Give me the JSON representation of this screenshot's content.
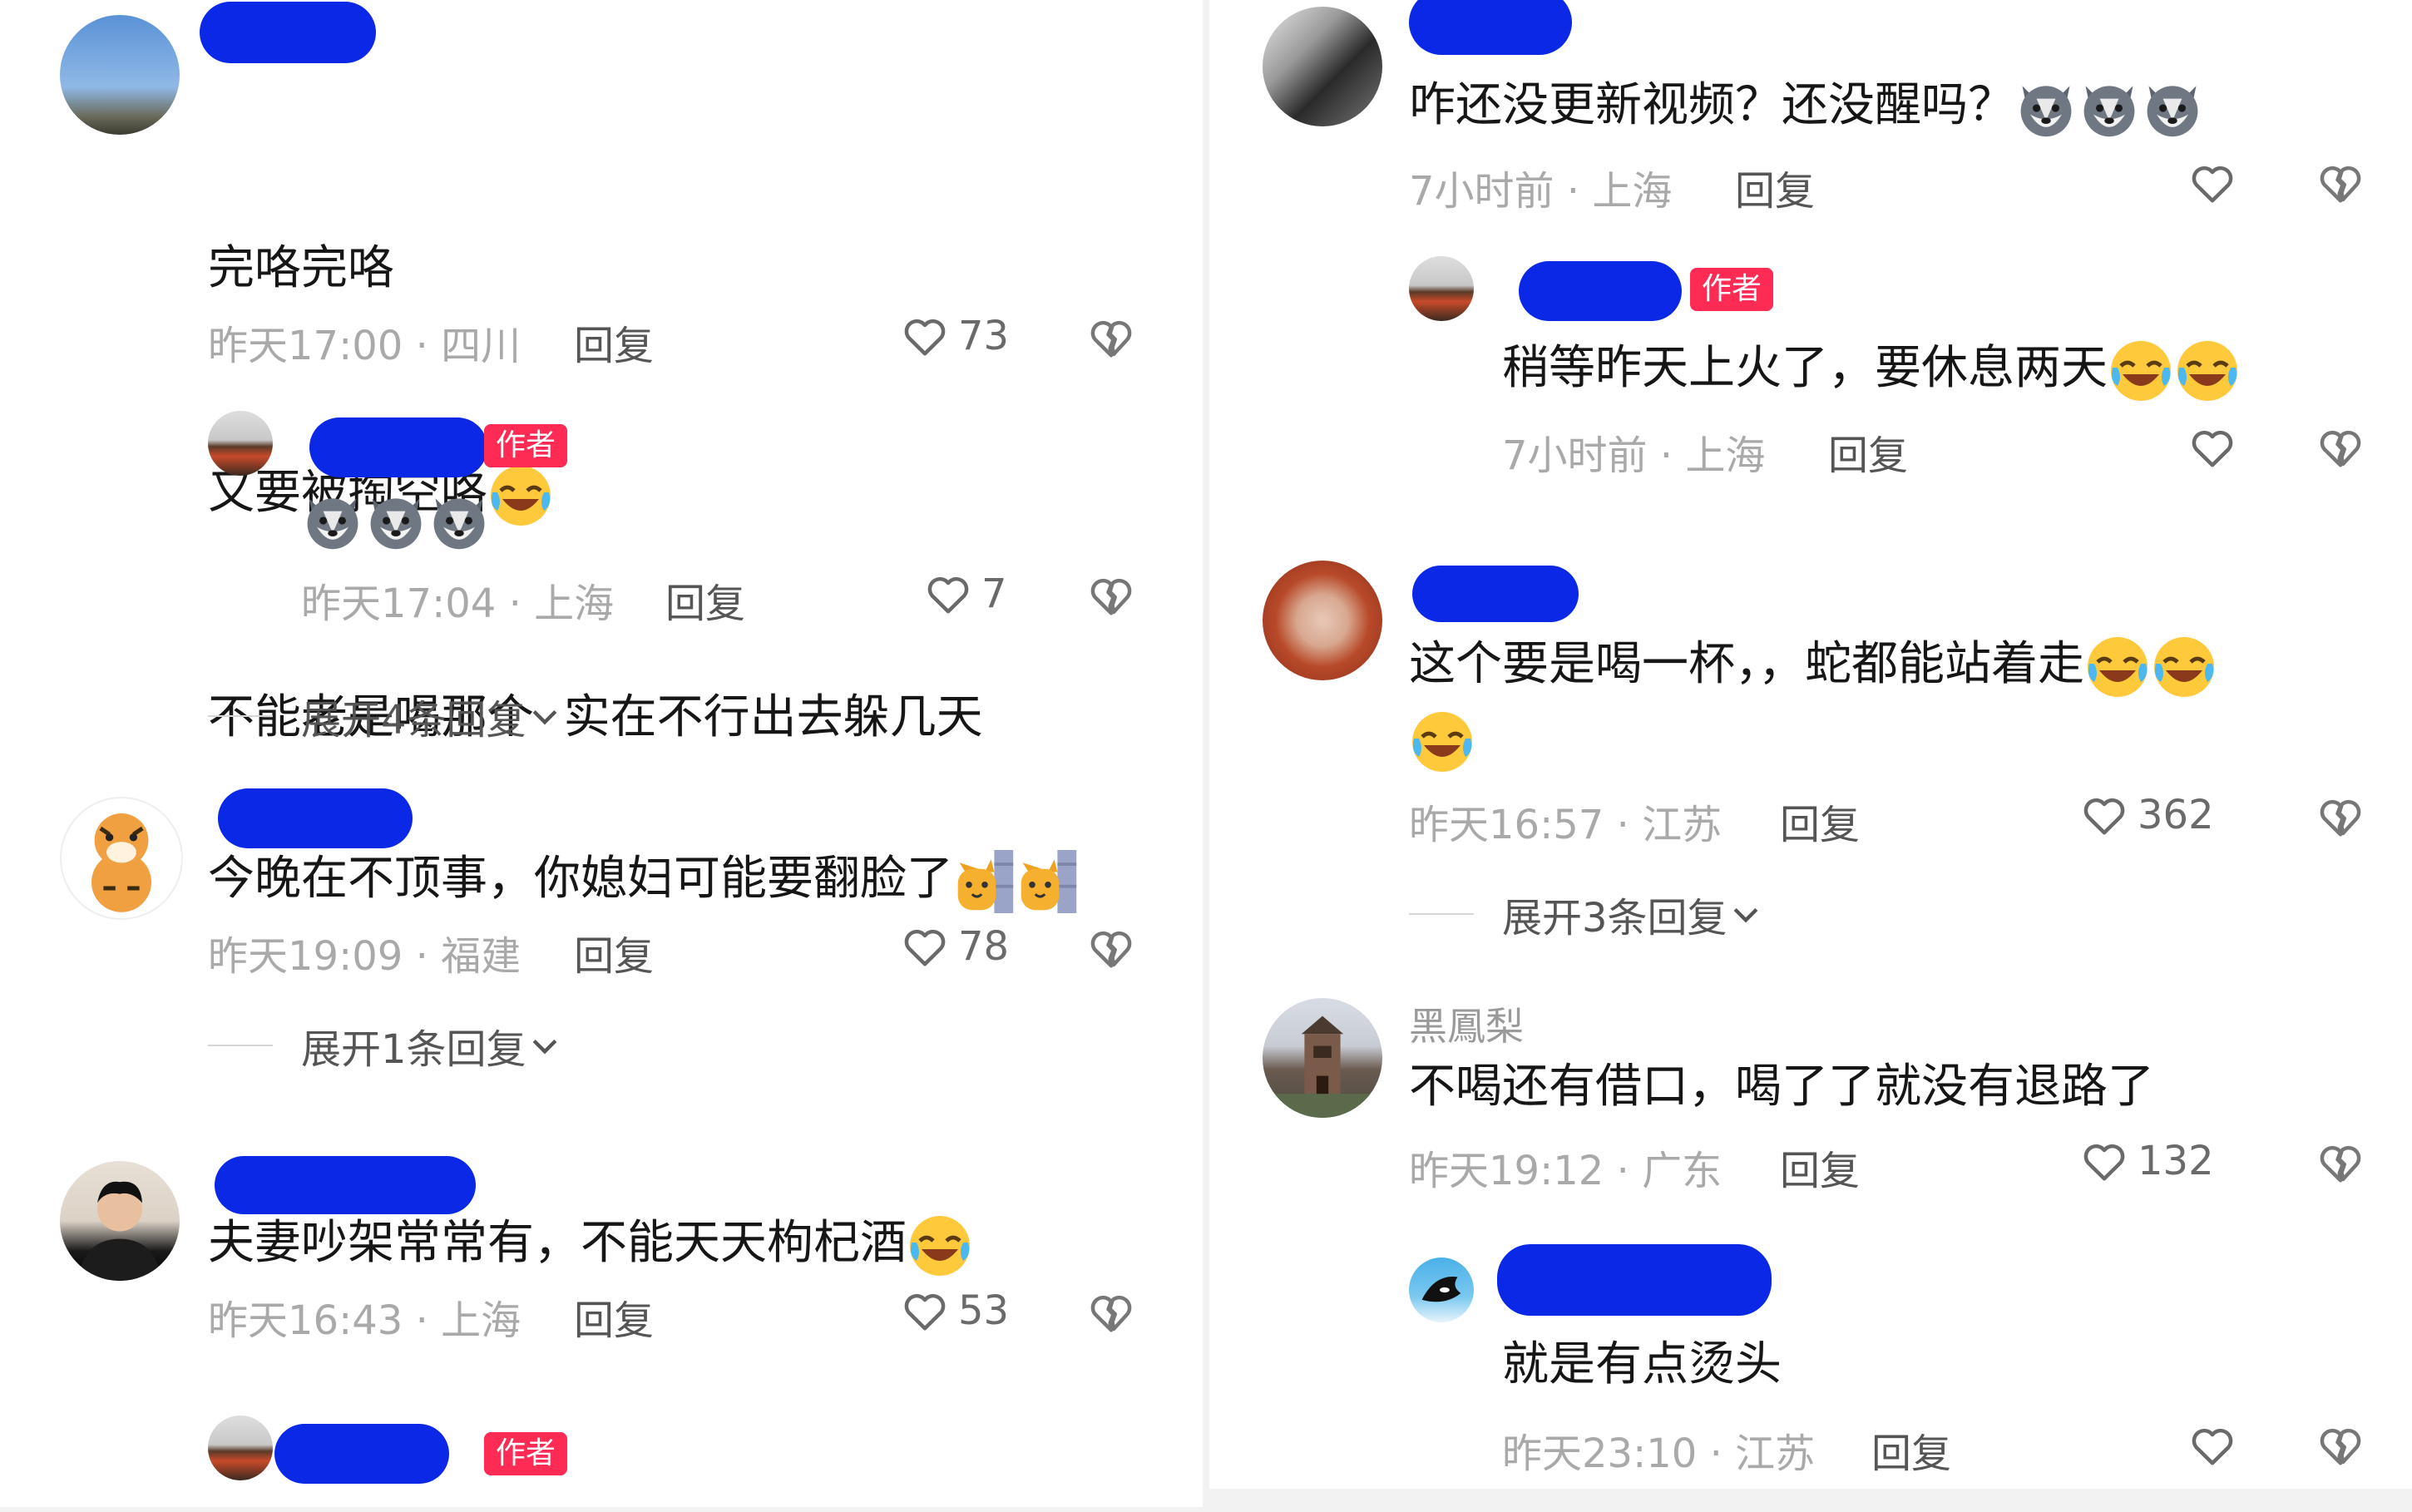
{
  "colors": {
    "redaction": "#0a28e6",
    "author_badge": "#fe2c55",
    "meta_gray": "#a9a9a9"
  },
  "author_badge_label": "作者",
  "reply_label": "回复",
  "left": {
    "c1": {
      "lines": [
        "完咯完咯",
        "又要被掏空咯",
        "不能老是喝那个  实在不行出去躲几天"
      ],
      "emoji_after_line2": "laugh-cry-emoji",
      "meta": "昨天17:00 · 四川",
      "likes": "73",
      "reply": {
        "emojis": [
          "husky-emoji",
          "husky-emoji",
          "husky-emoji"
        ],
        "meta": "昨天17:04 · 上海",
        "likes": "7"
      },
      "expand": "展开4条回复"
    },
    "c2": {
      "text": "今晚在不顶事，你媳妇可能要翻脸了",
      "emojis": [
        "cat-peek-emoji",
        "cat-peek-emoji"
      ],
      "meta": "昨天19:09 · 福建",
      "likes": "78",
      "expand": "展开1条回复"
    },
    "c3": {
      "text": "夫妻吵架常常有，不能天天枸杞酒",
      "emoji": "laugh-cry-emoji",
      "meta": "昨天16:43 · 上海",
      "likes": "53"
    }
  },
  "right": {
    "c1": {
      "text": "咋还没更新视频？还没醒吗？",
      "emojis": [
        "husky-emoji",
        "husky-emoji",
        "husky-emoji"
      ],
      "meta": "7小时前 · 上海",
      "reply": {
        "text": "稍等昨天上火了，要休息两天",
        "emojis": [
          "laugh-cry-emoji",
          "laugh-cry-emoji"
        ],
        "meta": "7小时前 · 上海"
      }
    },
    "c2": {
      "text": "这个要是喝一杯，，蛇都能站着走",
      "emojis": [
        "laugh-cry-emoji",
        "laugh-cry-emoji",
        "laugh-cry-emoji"
      ],
      "meta": "昨天16:57 · 江苏",
      "likes": "362",
      "expand": "展开3条回复"
    },
    "c3": {
      "username": "黑鳳梨",
      "text": "不喝还有借口，喝了了就没有退路了",
      "meta": "昨天19:12 · 广东",
      "likes": "132",
      "reply": {
        "text": "就是有点烫头",
        "meta": "昨天23:10 · 江苏"
      }
    }
  }
}
